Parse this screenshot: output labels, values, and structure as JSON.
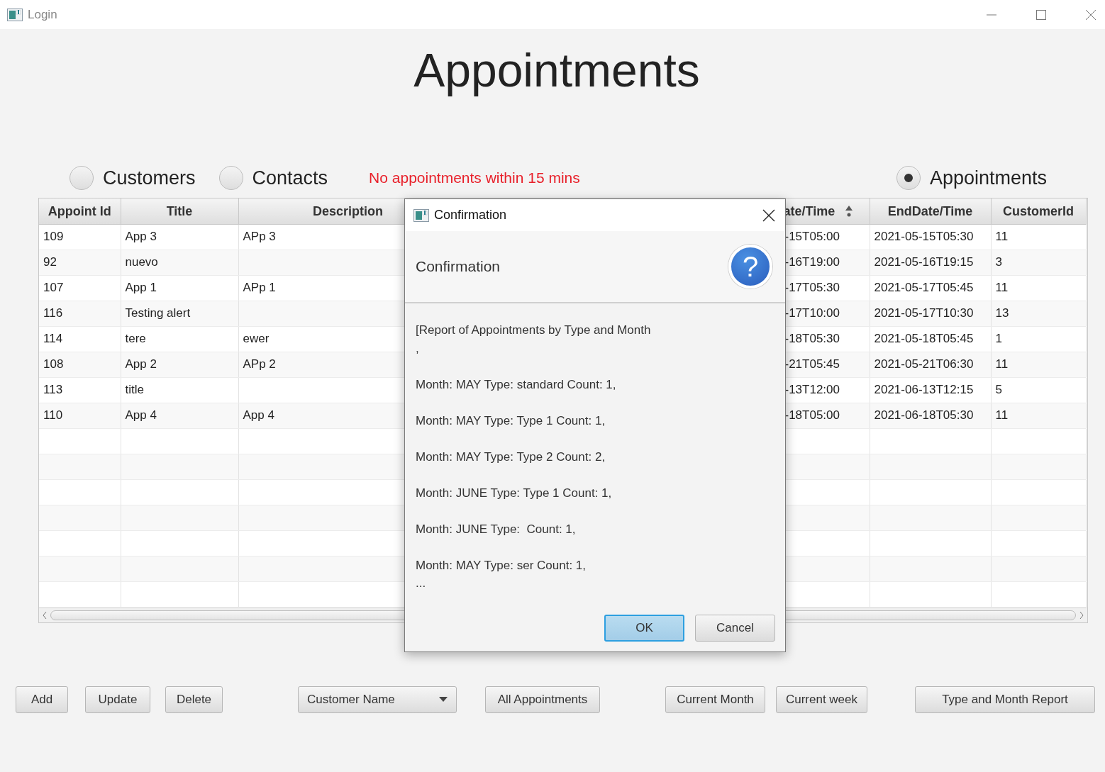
{
  "window": {
    "title": "Login"
  },
  "heading": "Appointments",
  "views": [
    {
      "label": "Customers",
      "selected": false
    },
    {
      "label": "Contacts",
      "selected": false
    },
    {
      "label": "Appointments",
      "selected": true
    }
  ],
  "alert": "No appointments within 15 mins",
  "table": {
    "columns": [
      {
        "label": "Appoint Id",
        "sorted": false
      },
      {
        "label": "Title",
        "sorted": false
      },
      {
        "label": "Description",
        "sorted": false
      },
      {
        "label": "ate/Time",
        "sorted": true
      },
      {
        "label": "EndDate/Time",
        "sorted": false
      },
      {
        "label": "CustomerId",
        "sorted": false
      }
    ],
    "rows": [
      [
        "109",
        "App 3",
        "APp 3",
        "-15T05:00",
        "2021-05-15T05:30",
        "11"
      ],
      [
        "92",
        "nuevo",
        "",
        "-16T19:00",
        "2021-05-16T19:15",
        "3"
      ],
      [
        "107",
        "App 1",
        "APp 1",
        "-17T05:30",
        "2021-05-17T05:45",
        "11"
      ],
      [
        "116",
        "Testing alert",
        "",
        "-17T10:00",
        "2021-05-17T10:30",
        "13"
      ],
      [
        "114",
        "tere",
        "ewer",
        "-18T05:30",
        "2021-05-18T05:45",
        "1"
      ],
      [
        "108",
        "App 2",
        "APp 2",
        "-21T05:45",
        "2021-05-21T06:30",
        "11"
      ],
      [
        "113",
        "title",
        "",
        "-13T12:00",
        "2021-06-13T12:15",
        "5"
      ],
      [
        "110",
        "App 4",
        "App 4",
        "-18T05:00",
        "2021-06-18T05:30",
        "11"
      ]
    ]
  },
  "dialog": {
    "title": "Confirmation",
    "header": "Confirmation",
    "icon": "?",
    "message": "[Report of Appointments by Type and Month\n,\n\nMonth: MAY Type: standard Count: 1,\n\nMonth: MAY Type: Type 1 Count: 1,\n\nMonth: MAY Type: Type 2 Count: 2,\n\nMonth: JUNE Type: Type 1 Count: 1,\n\nMonth: JUNE Type:  Count: 1,\n\nMonth: MAY Type: ser Count: 1,\n...",
    "buttons": [
      {
        "label": "OK",
        "default": true
      },
      {
        "label": "Cancel",
        "default": false
      }
    ]
  },
  "controls": [
    {
      "kind": "button",
      "label": "Add"
    },
    {
      "kind": "button",
      "label": "Update"
    },
    {
      "kind": "button",
      "label": "Delete"
    },
    {
      "kind": "combo",
      "label": "Customer Name"
    },
    {
      "kind": "button",
      "label": "All Appointments"
    },
    {
      "kind": "button",
      "label": "Current Month"
    },
    {
      "kind": "button",
      "label": "Current week"
    },
    {
      "kind": "button",
      "label": "Type  and Month Report"
    }
  ]
}
